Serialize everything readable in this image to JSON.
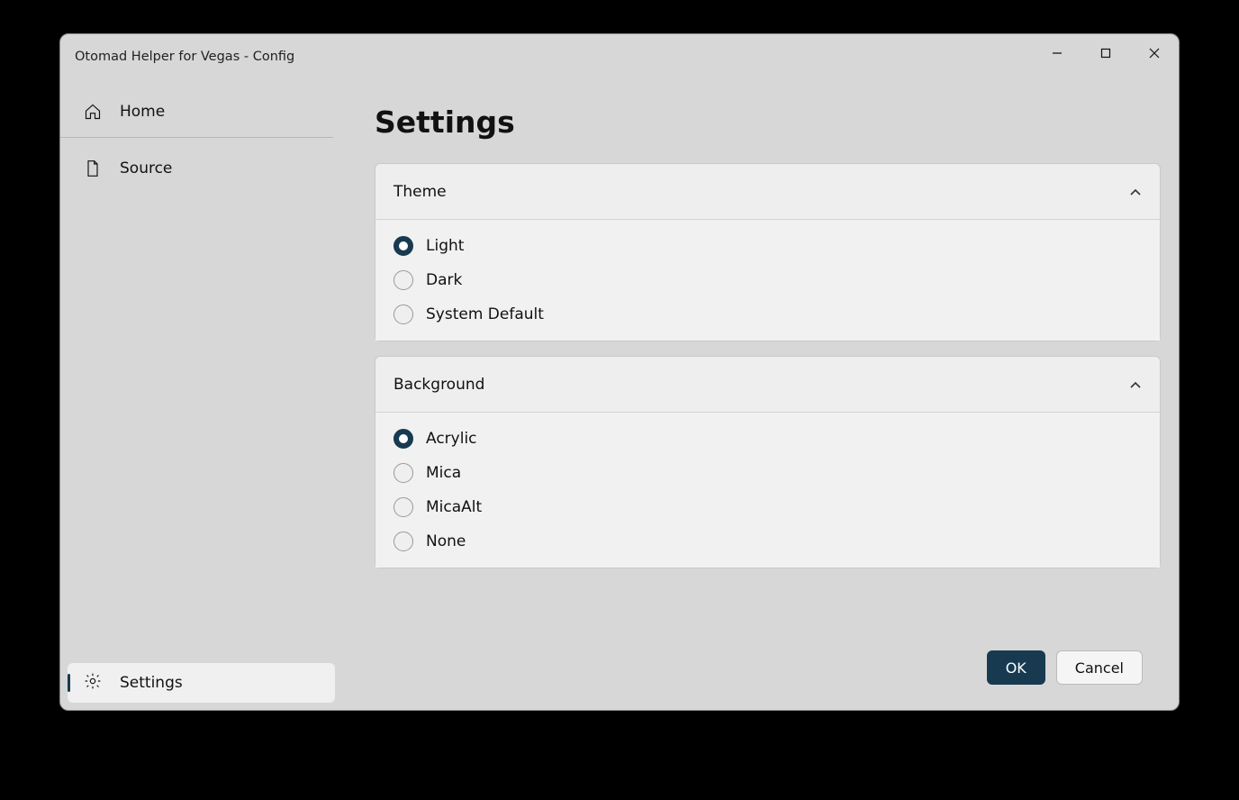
{
  "window": {
    "title": "Otomad Helper for Vegas - Config"
  },
  "sidebar": {
    "home": "Home",
    "source": "Source",
    "settings": "Settings"
  },
  "page": {
    "title": "Settings"
  },
  "cards": {
    "theme": {
      "title": "Theme",
      "options": {
        "light": "Light",
        "dark": "Dark",
        "system": "System Default"
      },
      "selected": "light"
    },
    "background": {
      "title": "Background",
      "options": {
        "acrylic": "Acrylic",
        "mica": "Mica",
        "micaalt": "MicaAlt",
        "none": "None"
      },
      "selected": "acrylic"
    }
  },
  "footer": {
    "ok": "OK",
    "cancel": "Cancel"
  }
}
